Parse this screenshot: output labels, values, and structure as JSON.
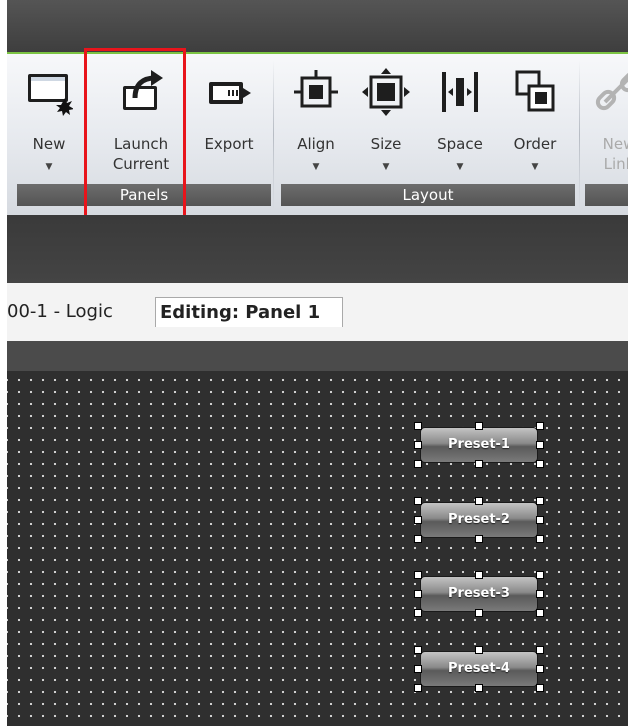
{
  "ribbon": {
    "buttons": {
      "new": {
        "label": "New"
      },
      "launch_current": {
        "line1": "Launch",
        "line2": "Current"
      },
      "export": {
        "label": "Export"
      },
      "align": {
        "label": "Align"
      },
      "size": {
        "label": "Size"
      },
      "space": {
        "label": "Space"
      },
      "order": {
        "label": "Order"
      },
      "new_link": {
        "line1": "New",
        "line2": "Link"
      }
    },
    "groups": {
      "panels": "Panels",
      "layout": "Layout"
    },
    "dropdown_arrow": "▼"
  },
  "tabs": {
    "inactive": "00-1 - Logic",
    "active": "Editing: Panel 1"
  },
  "canvas": {
    "presets": [
      "Preset-1",
      "Preset-2",
      "Preset-3",
      "Preset-4"
    ]
  },
  "colors": {
    "highlight": "#e8141b",
    "ribbon_accent": "#7cc443"
  }
}
